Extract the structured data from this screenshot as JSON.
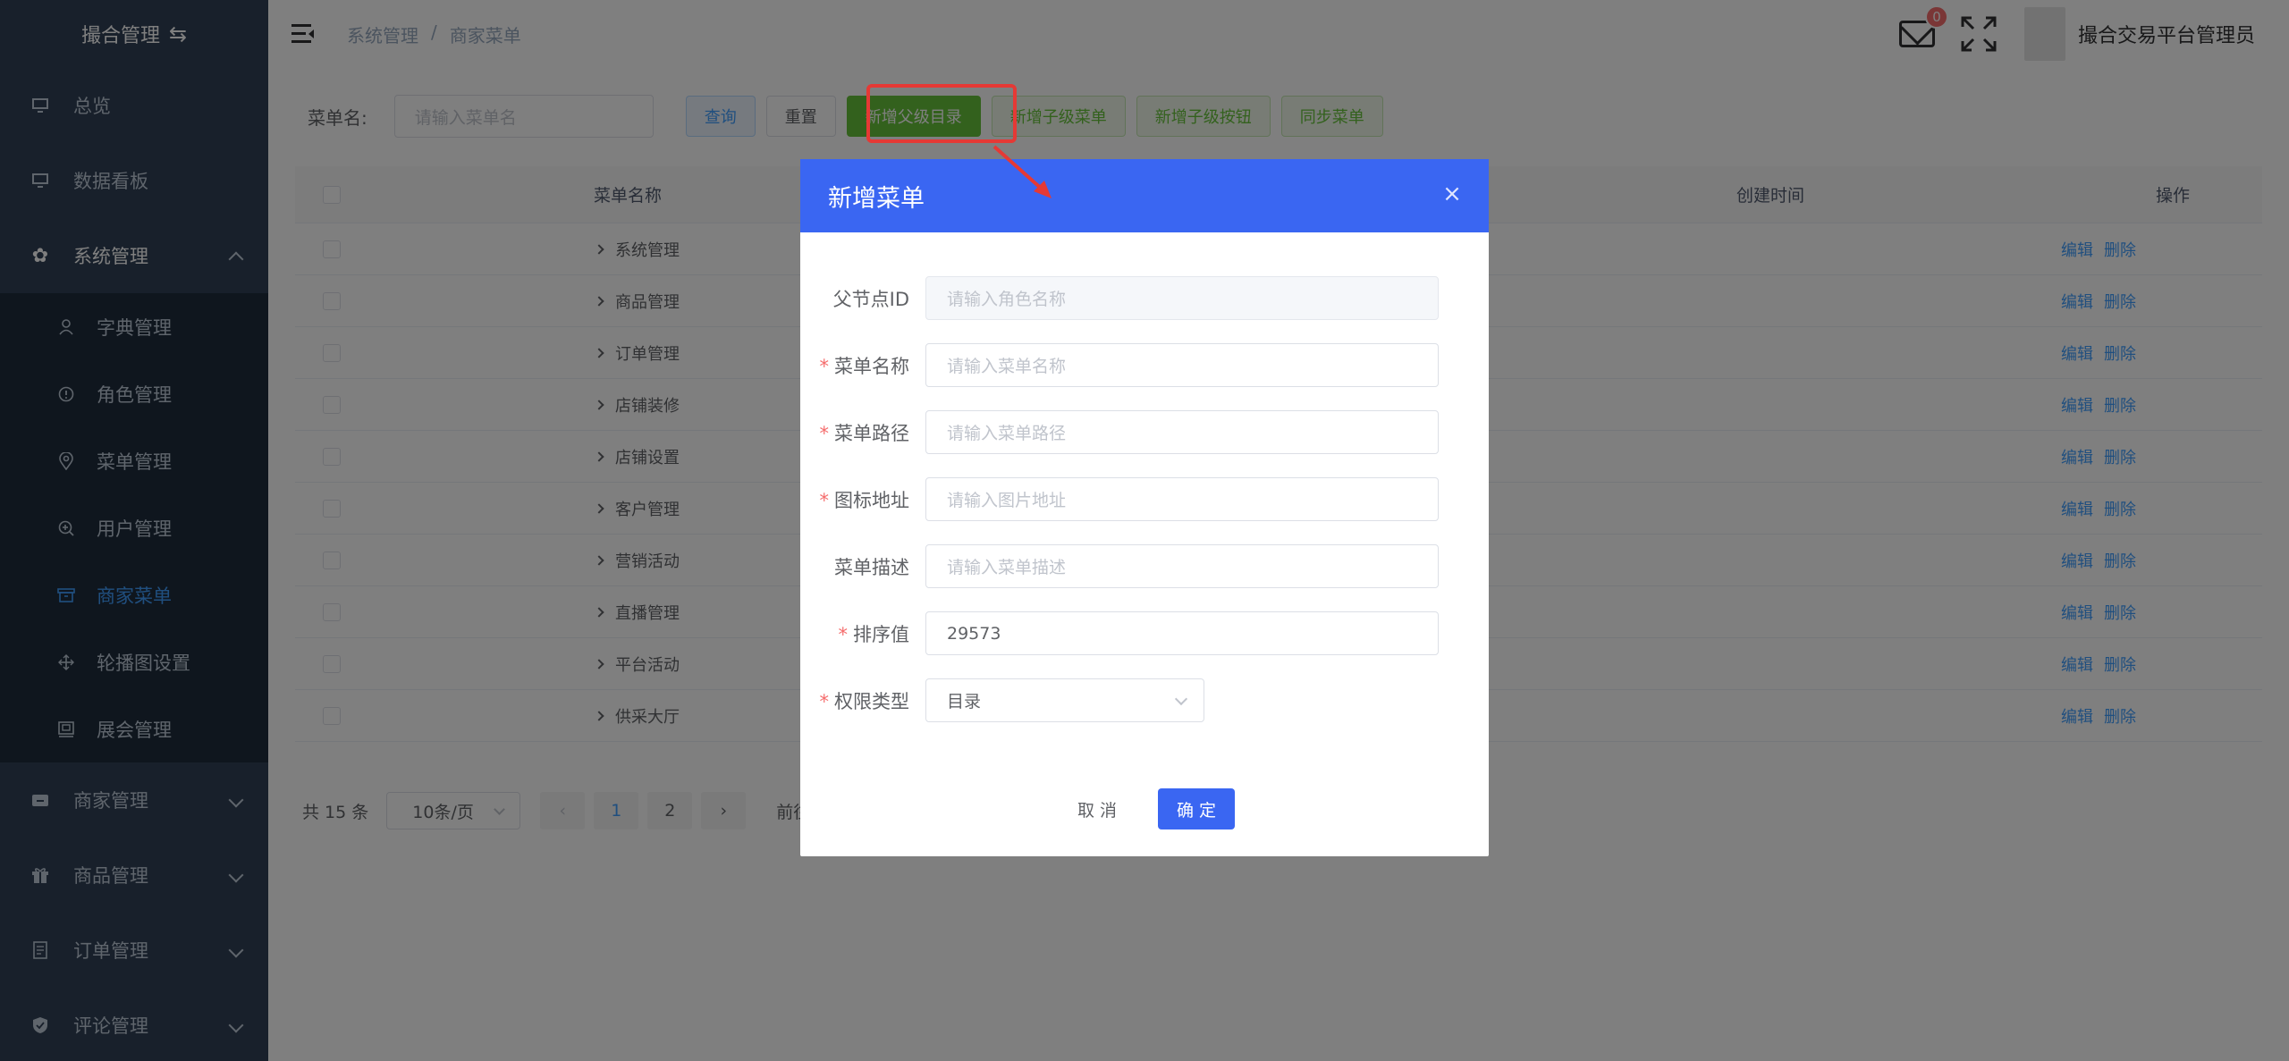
{
  "sidebar": {
    "logo": "撮合管理",
    "items": [
      {
        "label": "总览"
      },
      {
        "label": "数据看板"
      },
      {
        "label": "系统管理"
      },
      {
        "label": "商家管理"
      },
      {
        "label": "商品管理"
      },
      {
        "label": "订单管理"
      },
      {
        "label": "评论管理"
      }
    ],
    "sub_items": [
      {
        "label": "字典管理"
      },
      {
        "label": "角色管理"
      },
      {
        "label": "菜单管理"
      },
      {
        "label": "用户管理"
      },
      {
        "label": "商家菜单"
      },
      {
        "label": "轮播图设置"
      },
      {
        "label": "展会管理"
      }
    ]
  },
  "header": {
    "breadcrumb": [
      "系统管理",
      "/",
      "商家菜单"
    ],
    "badge": "0",
    "username": "撮合交易平台管理员"
  },
  "search": {
    "label": "菜单名:",
    "placeholder": "请输入菜单名",
    "buttons": [
      "查询",
      "重置",
      "新增父级目录",
      "新增子级菜单",
      "新增子级按钮",
      "同步菜单"
    ]
  },
  "table": {
    "headers": [
      "菜单名称",
      "创建时间",
      "操作"
    ],
    "rows": [
      "系统管理",
      "商品管理",
      "订单管理",
      "店铺装修",
      "店铺设置",
      "客户管理",
      "营销活动",
      "直播管理",
      "平台活动",
      "供采大厅"
    ],
    "edit_label": "编辑",
    "delete_label": "删除"
  },
  "pagination": {
    "total": "共 15 条",
    "page_size": "10条/页",
    "pages": [
      "1",
      "2"
    ],
    "goto": "前往"
  },
  "dialog": {
    "title": "新增菜单",
    "fields": [
      {
        "label": "父节点ID",
        "required": false,
        "placeholder": "请输入角色名称"
      },
      {
        "label": "菜单名称",
        "required": true,
        "placeholder": "请输入菜单名称"
      },
      {
        "label": "菜单路径",
        "required": true,
        "placeholder": "请输入菜单路径"
      },
      {
        "label": "图标地址",
        "required": true,
        "placeholder": "请输入图片地址"
      },
      {
        "label": "菜单描述",
        "required": false,
        "placeholder": "请输入菜单描述"
      },
      {
        "label": "排序值",
        "required": true,
        "value": "29573"
      },
      {
        "label": "权限类型",
        "required": true,
        "value": "目录"
      }
    ],
    "cancel": "取 消",
    "confirm": "确 定"
  },
  "colors": {
    "sidebar_bg": "#304156",
    "accent": "#409eff",
    "dialog_header": "#3a66f2",
    "highlight": "#e53935"
  }
}
